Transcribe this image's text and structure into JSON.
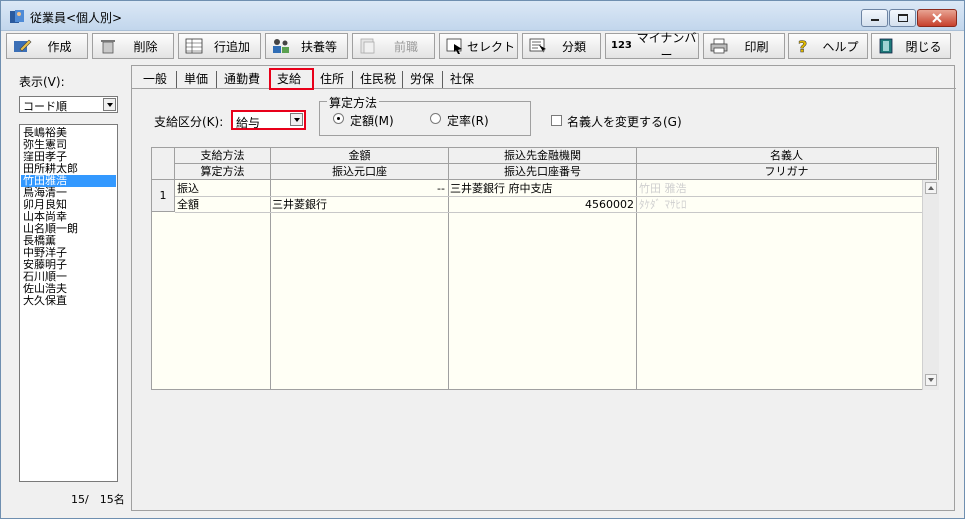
{
  "window": {
    "title": "従業員<個人別>"
  },
  "toolbar": {
    "buttons": [
      {
        "label": "作成",
        "icon": "create-icon"
      },
      {
        "label": "削除",
        "icon": "trash-icon"
      },
      {
        "label": "行追加",
        "icon": "add-row-icon"
      },
      {
        "label": "扶養等",
        "icon": "dependents-icon"
      },
      {
        "label": "前職",
        "icon": "previous-job-icon",
        "disabled": true
      },
      {
        "label": "セレクト",
        "icon": "select-icon"
      },
      {
        "label": "分類",
        "icon": "classify-icon"
      },
      {
        "label": "マイナンバー",
        "icon": "mynumber-icon",
        "prefix": "123"
      },
      {
        "label": "印刷",
        "icon": "printer-icon"
      },
      {
        "label": "ヘルプ",
        "icon": "help-icon"
      },
      {
        "label": "閉じる",
        "icon": "close-book-icon"
      }
    ]
  },
  "sidebar": {
    "display_label": "表示(V):",
    "sort_value": "コード順",
    "employees": [
      "長嶋裕美",
      "弥生憲司",
      "窪田孝子",
      "田所耕太郎",
      "竹田雅浩",
      "鳥海清一",
      "卯月良知",
      "山本尚幸",
      "山名順一朗",
      "長橋薫",
      "中野洋子",
      "安藤明子",
      "石川順一",
      "佐山浩夫",
      "大久保直"
    ],
    "selected_index": 4,
    "count": "15/　15名"
  },
  "tabs": [
    {
      "label": "一般"
    },
    {
      "label": "単価"
    },
    {
      "label": "通勤費"
    },
    {
      "label": "支給",
      "active": true
    },
    {
      "label": "住所"
    },
    {
      "label": "住民税"
    },
    {
      "label": "労保"
    },
    {
      "label": "社保"
    }
  ],
  "payment": {
    "division_label": "支給区分(K):",
    "division_value": "給与",
    "calc_legend": "算定方法",
    "fixed_label": "定額(M)",
    "rate_label": "定率(R)",
    "selected_method": "fixed",
    "nominee_change_label": "名義人を変更する(G)",
    "nominee_change_checked": false
  },
  "grid": {
    "headers": [
      {
        "top": "支給方法",
        "bottom": "算定方法"
      },
      {
        "top": "金額",
        "bottom": "振込元口座"
      },
      {
        "top": "振込先金融機関",
        "bottom": "振込先口座番号"
      },
      {
        "top": "名義人",
        "bottom": "フリガナ"
      }
    ],
    "rows": [
      {
        "num": "1",
        "method": "振込",
        "calc": "全額",
        "amount": "--",
        "source_account": "三井菱銀行",
        "bank": "三井菱銀行 府中支店",
        "account_no": "4560002",
        "nominee": "竹田 雅浩",
        "furigana": "ﾀｹﾀﾞ ﾏｻﾋﾛ"
      }
    ]
  },
  "colors": {
    "highlight": "#e8001a",
    "selection": "#3399ff",
    "grid_bg": "#fffff5"
  }
}
